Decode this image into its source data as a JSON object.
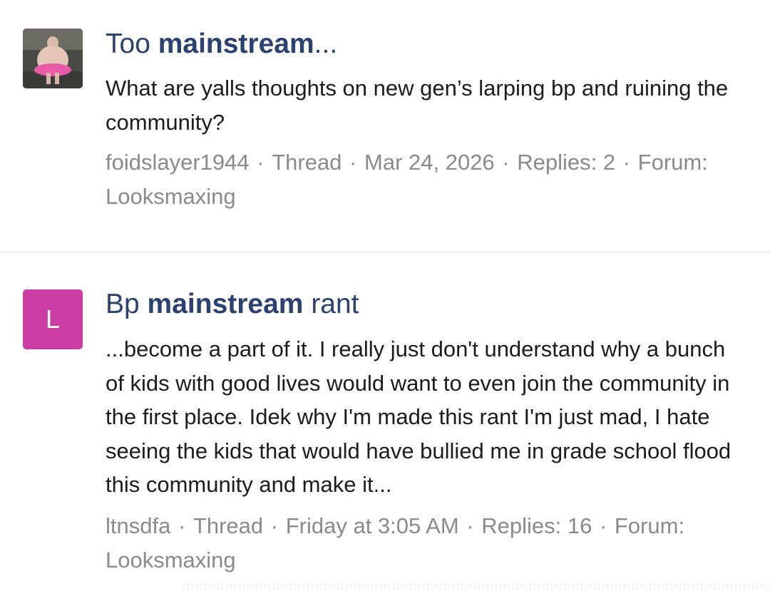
{
  "results": [
    {
      "avatar": {
        "kind": "photo",
        "icon": "user-photo-avatar"
      },
      "title_pre": "Too ",
      "title_bold": "mainstream",
      "title_post": "...",
      "snippet": "What are yalls thoughts on new gen’s larping bp and ruining the community?",
      "author": "foidslayer1944",
      "type": "Thread",
      "date": "Mar 24, 2026",
      "replies": "Replies: 2",
      "forum": "Forum: Looksmaxing"
    },
    {
      "avatar": {
        "kind": "letter",
        "letter": "L",
        "color": "#cc3da4"
      },
      "title_pre": "Bp ",
      "title_bold": "mainstream",
      "title_post": " rant",
      "snippet": "...become a part of it. I really just don't understand why a bunch of kids with good lives would want to even join the community in the first place. Idek why I'm made this rant I'm just mad, I hate seeing the kids that would have bullied me in grade school flood this community and make it...",
      "author": "ltnsdfa",
      "type": "Thread",
      "date": "Friday at 3:05 AM",
      "replies": "Replies: 16",
      "forum": "Forum: Looksmaxing"
    }
  ],
  "colors": {
    "title": "#2b4170",
    "meta": "#8a8a8a",
    "divider": "#e2e2e2"
  }
}
